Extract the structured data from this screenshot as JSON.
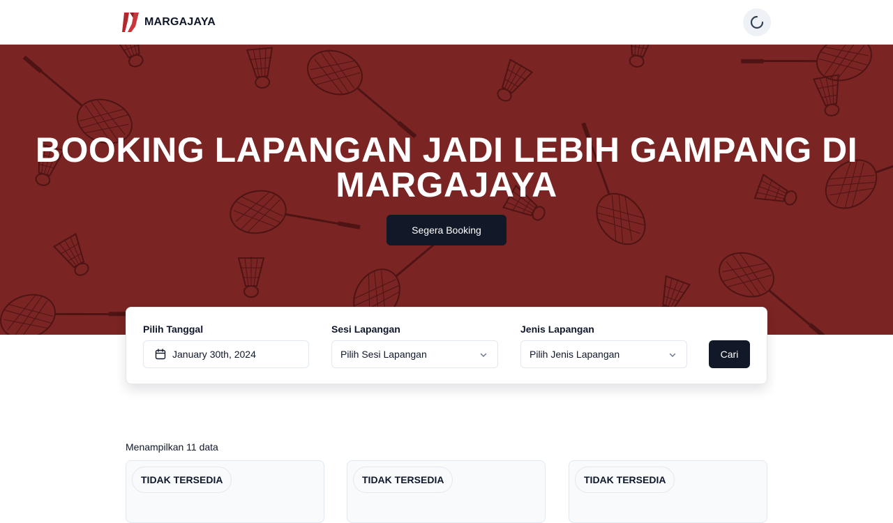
{
  "header": {
    "brand_name": "MARGAJAYA",
    "logo_icon": "margajaya-logo-icon",
    "user_icon": "loading-spinner-icon"
  },
  "hero": {
    "title": "BOOKING LAPANGAN JADI LEBIH GAMPANG DI MARGAJAYA",
    "cta_label": "Segera Booking",
    "background_color": "#7a2424",
    "pattern_icons": [
      "badminton-racket-icon",
      "shuttlecock-icon"
    ]
  },
  "filter": {
    "date_label": "Pilih Tanggal",
    "date_value": "January 30th, 2024",
    "date_icon": "calendar-icon",
    "session_label": "Sesi Lapangan",
    "session_placeholder": "Pilih Sesi Lapangan",
    "type_label": "Jenis Lapangan",
    "type_placeholder": "Pilih Jenis Lapangan",
    "search_label": "Cari"
  },
  "results": {
    "count_text": "Menampilkan 11 data",
    "cards": [
      {
        "status": "TIDAK TERSEDIA"
      },
      {
        "status": "TIDAK TERSEDIA"
      },
      {
        "status": "TIDAK TERSEDIA"
      }
    ]
  },
  "colors": {
    "hero_bg": "#7a2424",
    "primary_button": "#111827",
    "logo_red": "#b3282d"
  }
}
